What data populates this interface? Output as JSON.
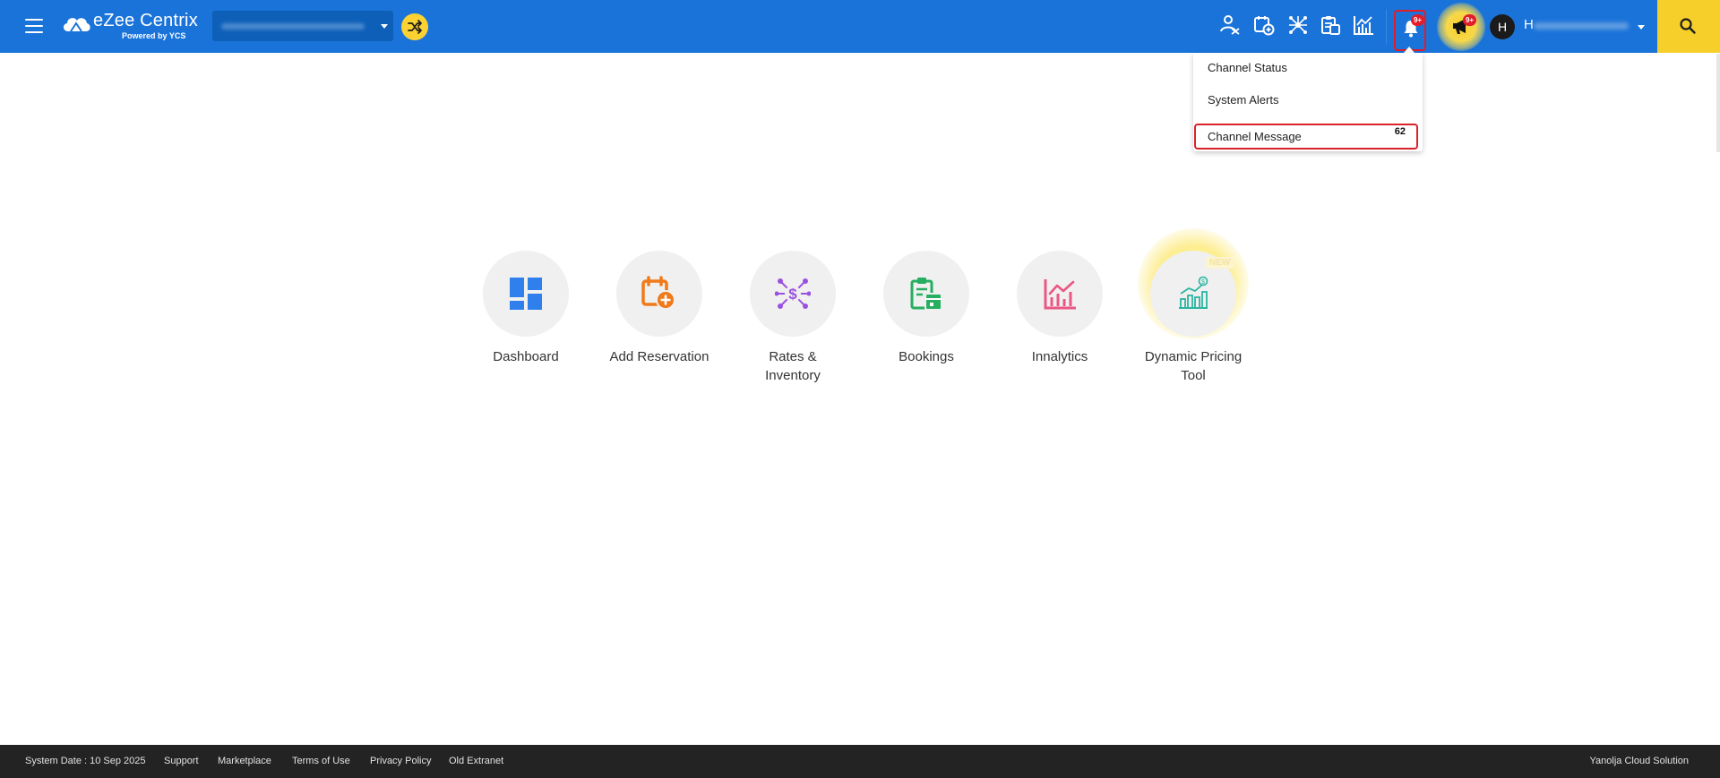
{
  "header": {
    "brand_name": "eZee Centrix",
    "brand_sub": "Powered by YCS",
    "notification_badge": "9+",
    "announcement_badge": "9+",
    "user_initial": "H",
    "user_name_prefix": "H",
    "accent_color": "#1a73d9",
    "highlight_color": "#f6cf2a"
  },
  "notifications": {
    "items": [
      {
        "label": "Channel Status"
      },
      {
        "label": "System Alerts"
      },
      {
        "label": "Channel Message",
        "count": "62"
      }
    ]
  },
  "tiles": [
    {
      "label": "Dashboard",
      "icon": "dashboard-icon"
    },
    {
      "label": "Add Reservation",
      "icon": "calendar-add-icon"
    },
    {
      "label": "Rates & Inventory",
      "icon": "rates-network-icon"
    },
    {
      "label": "Bookings",
      "icon": "bookings-clipboard-icon"
    },
    {
      "label": "Innalytics",
      "icon": "analytics-chart-icon"
    },
    {
      "label": "Dynamic Pricing Tool",
      "icon": "pricing-growth-icon",
      "tag": "NEW"
    }
  ],
  "footer": {
    "system_date": "System Date : 10 Sep 2025",
    "links": [
      "Support",
      "Marketplace",
      "Terms of Use",
      "Privacy Policy",
      "Old Extranet"
    ],
    "company": "Yanolja Cloud Solution"
  }
}
